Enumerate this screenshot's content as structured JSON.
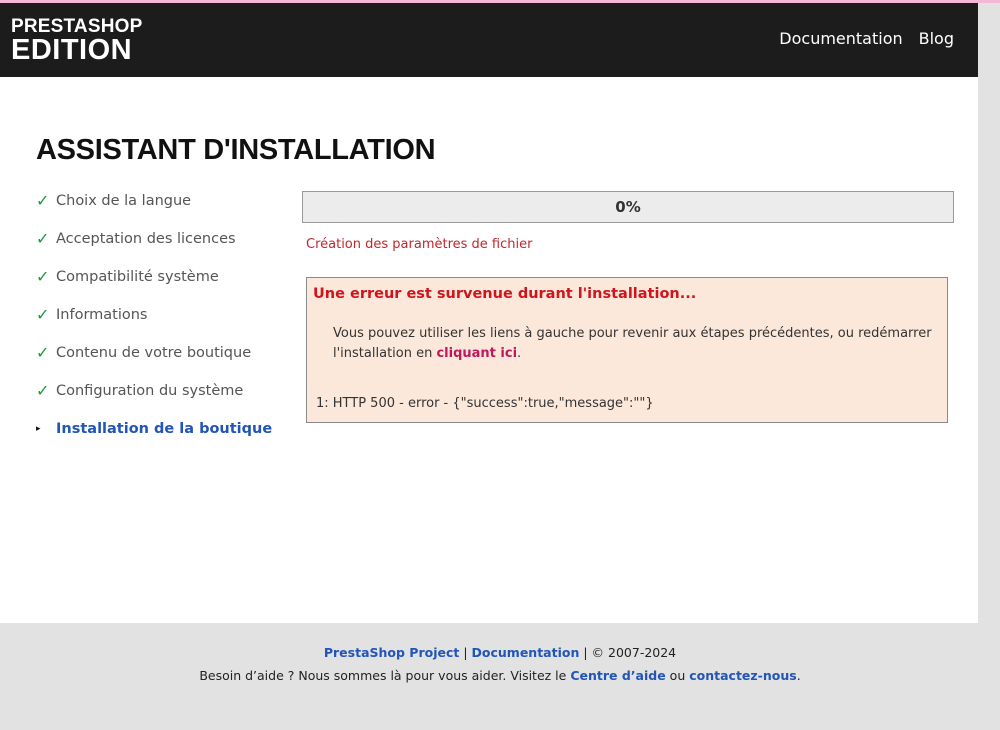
{
  "header": {
    "logo_top": "PRESTASHOP",
    "logo_bottom": "EDITION",
    "nav": {
      "documentation": "Documentation",
      "blog": "Blog"
    }
  },
  "page": {
    "title": "ASSISTANT D'INSTALLATION"
  },
  "steps": [
    {
      "label": "Choix de la langue",
      "mark": "✓",
      "state": "done"
    },
    {
      "label": "Acceptation des licences",
      "mark": "✓",
      "state": "done"
    },
    {
      "label": "Compatibilité système",
      "mark": "✓",
      "state": "done"
    },
    {
      "label": "Informations",
      "mark": "✓",
      "state": "done"
    },
    {
      "label": "Contenu de votre boutique",
      "mark": "✓",
      "state": "done"
    },
    {
      "label": "Configuration du système",
      "mark": "✓",
      "state": "done"
    },
    {
      "label": "Installation de la boutique",
      "mark": "▸",
      "state": "current"
    }
  ],
  "progress": {
    "value": 0,
    "label": "0%"
  },
  "status_text": "Création des paramètres de fichier",
  "error": {
    "title": "Une erreur est survenue durant l'installation...",
    "message_before": "Vous pouvez utiliser les liens à gauche pour revenir aux étapes précédentes, ou redémarrer l'installation en ",
    "restart_link": "cliquant ici",
    "message_after": ".",
    "detail": "1: HTTP 500 - error - {\"success\":true,\"message\":\"\"}"
  },
  "footer": {
    "project_link": "PrestaShop Project",
    "sep1": " | ",
    "docs_link": "Documentation",
    "copyright": " | © 2007-2024",
    "help_before": "Besoin d’aide ? Nous sommes là pour vous aider. Visitez le ",
    "help_center_link": "Centre d’aide",
    "help_middle": " ou ",
    "contact_link": "contactez-nous",
    "help_after": "."
  },
  "colors": {
    "header_bg": "#1c1c1c",
    "check": "#1b9a3a",
    "current_step": "#2155b8",
    "error_red": "#d0141d",
    "error_bg": "#fbe8da",
    "link_pink": "#c0175d",
    "footer_bg": "#e2e2e2"
  }
}
